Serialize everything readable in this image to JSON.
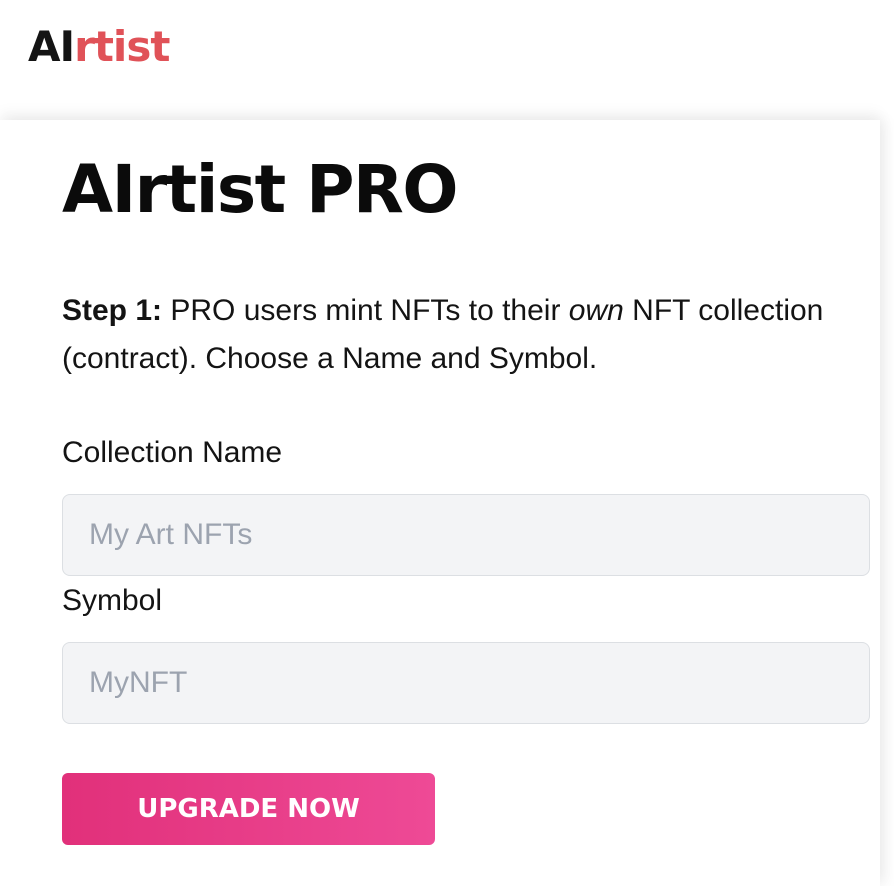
{
  "header": {
    "logo": {
      "part1": "AI",
      "part2": "rtist"
    }
  },
  "main": {
    "title": "AIrtist PRO",
    "intro": {
      "step_label": "Step 1:",
      "text_before": " PRO users mint NFTs to their ",
      "emphasis": "own",
      "text_after": " NFT collection (contract). Choose a Name and Symbol."
    },
    "collection_name": {
      "label": "Collection Name",
      "value": "",
      "placeholder": "My Art NFTs"
    },
    "symbol": {
      "label": "Symbol",
      "value": "",
      "placeholder": "MyNFT"
    },
    "upgrade_button": "UPGRADE NOW"
  },
  "colors": {
    "logo_dark": "#141414",
    "logo_accent": "#e05258",
    "button_gradient_start": "#e1307a",
    "button_gradient_end": "#ee4a96",
    "input_background": "#f3f4f6",
    "placeholder": "#9ca3af"
  }
}
